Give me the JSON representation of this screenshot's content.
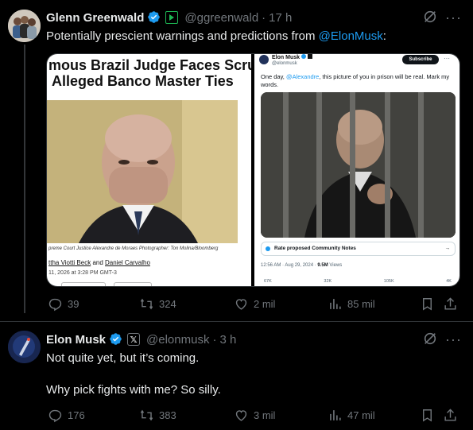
{
  "tweet1": {
    "author_name": "Glenn Greenwald",
    "handle": "@ggreenwald",
    "time": "17 h",
    "text_prefix": "Potentially prescient warnings and predictions from ",
    "mention": "@ElonMusk",
    "text_suffix": ":",
    "image_left": {
      "headline_line1": "mous Brazil Judge Faces Scru",
      "headline_line2": "Alleged Banco Master Ties",
      "caption": "preme Court Justice Alexandre de Moraes Photographer: Ton Molina/Bloomberg",
      "byline_a": "ttha Viotti Beck",
      "byline_and": " and ",
      "byline_b": "Daniel Carvalho",
      "date": "11, 2026 at 3:28 PM GMT-3"
    },
    "image_right": {
      "name": "Elon Musk",
      "handle": "@elonmusk",
      "subscribe": "Subscribe",
      "text_prefix": "One day, ",
      "mention": "@Alexandre",
      "text_suffix": ", this picture of you in prison will be real. Mark my words.",
      "community_notes": "Rate proposed Community Notes",
      "meta_time": "12:56 AM · Aug 29, 2024 · ",
      "meta_views": "9.5M",
      "meta_views_label": " Views",
      "counts": [
        "67K",
        "32K",
        "105K",
        "4K"
      ]
    },
    "actions": {
      "replies": "39",
      "reposts": "324",
      "likes": "2 mil",
      "views": "85 mil"
    }
  },
  "tweet2": {
    "author_name": "Elon Musk",
    "handle": "@elonmusk",
    "time": "3 h",
    "line1": "Not quite yet, but it’s coming.",
    "line2": "Why pick fights with me? So silly.",
    "actions": {
      "replies": "176",
      "reposts": "383",
      "likes": "3 mil",
      "views": "47 mil"
    }
  },
  "colors": {
    "background": "#000000",
    "text": "#e7e9ea",
    "muted": "#71767b",
    "accent": "#1d9bf0",
    "verified_gold": "#e2b719"
  }
}
